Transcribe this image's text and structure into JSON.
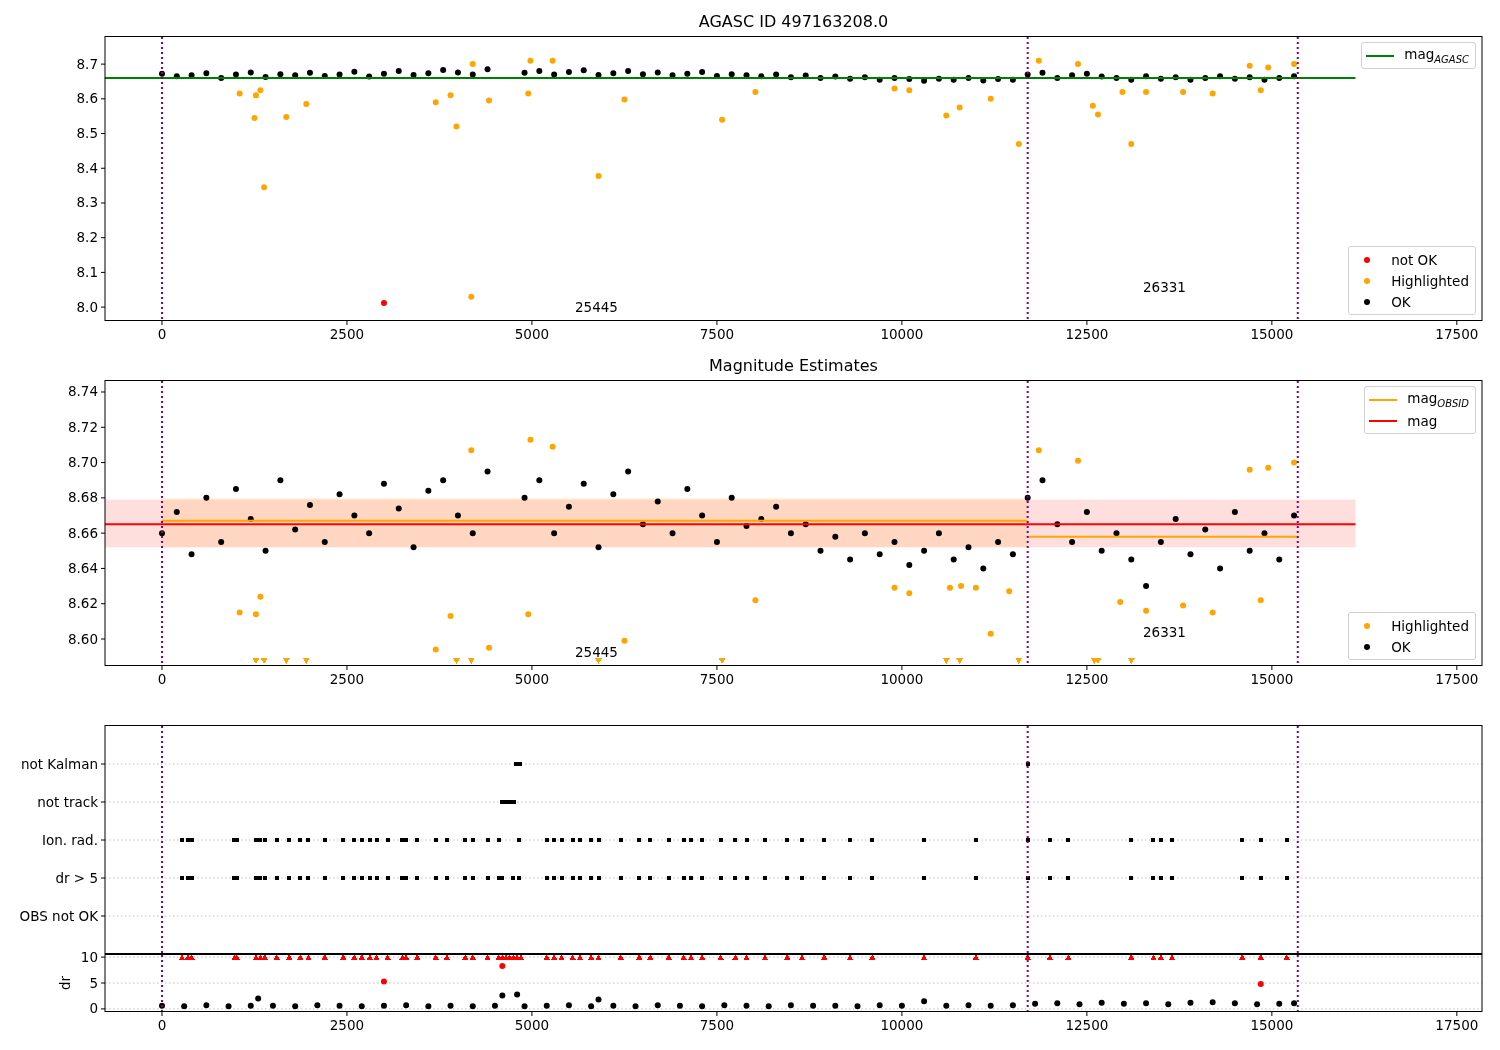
{
  "panels": [
    {
      "chart_data": {
        "type": "scatter",
        "title": "AGASC ID 497163208.0",
        "legend": "right",
        "xlim": [
          -770,
          17840
        ],
        "ylim": [
          7.96,
          8.781
        ],
        "xticks": [
          0,
          2500,
          5000,
          7500,
          10000,
          12500,
          15000,
          17500
        ],
        "yticks": [
          {
            "value": 8.0,
            "label": "8.0"
          },
          {
            "value": 8.1,
            "label": "8.1"
          },
          {
            "value": 8.2,
            "label": "8.2"
          },
          {
            "value": 8.3,
            "label": "8.3"
          },
          {
            "value": 8.4,
            "label": "8.4"
          },
          {
            "value": 8.5,
            "label": "8.5"
          },
          {
            "value": 8.6,
            "label": "8.6"
          },
          {
            "value": 8.7,
            "label": "8.7"
          }
        ],
        "series": [
          {
            "name": "mag$_{AGASC}$",
            "type": "line",
            "color": "#008000",
            "x": [
              -770,
              16130
            ],
            "values": [
              8.66,
              8.66
            ]
          },
          {
            "name": "not OK",
            "type": "scatter",
            "color": "#ff0000",
            "x": [
              3000
            ],
            "values": [
              8.012
            ]
          },
          {
            "name": "Highlighted",
            "type": "scatter",
            "color": "#ffa500",
            "x": [
              1050,
              1250,
              1270,
              1330,
              1380,
              1680,
              1950,
              3700,
              3900,
              3980,
              4180,
              4200,
              4420,
              4950,
              4980,
              5280,
              5900,
              6250,
              7570,
              8020,
              9900,
              10100,
              10600,
              10780,
              11200,
              11580,
              11850,
              12380,
              12580,
              12650,
              12980,
              13100,
              13300,
              13800,
              14200,
              14700,
              14850,
              14950,
              15300
            ],
            "values": [
              8.615,
              8.545,
              8.61,
              8.625,
              8.345,
              8.548,
              8.585,
              8.59,
              8.61,
              8.52,
              8.03,
              8.7,
              8.595,
              8.615,
              8.71,
              8.71,
              8.378,
              8.598,
              8.54,
              8.62,
              8.63,
              8.625,
              8.552,
              8.575,
              8.6,
              8.47,
              8.71,
              8.7,
              8.58,
              8.555,
              8.62,
              8.47,
              8.62,
              8.62,
              8.615,
              8.695,
              8.625,
              8.69,
              8.7
            ]
          },
          {
            "name": "OK",
            "type": "scatter",
            "color": "#000000",
            "x": [
              0,
              200,
              400,
              600,
              800,
              1000,
              1200,
              1400,
              1600,
              1800,
              2000,
              2200,
              2400,
              2600,
              2800,
              3000,
              3200,
              3400,
              3600,
              3800,
              4000,
              4200,
              4400,
              4900,
              5100,
              5300,
              5500,
              5700,
              5900,
              6100,
              6300,
              6500,
              6700,
              6900,
              7100,
              7300,
              7500,
              7700,
              7900,
              8100,
              8300,
              8500,
              8700,
              8900,
              9100,
              9300,
              9500,
              9700,
              9900,
              10100,
              10300,
              10500,
              10700,
              10900,
              11100,
              11300,
              11500,
              11700,
              11900,
              12100,
              12300,
              12500,
              12700,
              12900,
              13100,
              13300,
              13500,
              13700,
              13900,
              14100,
              14300,
              14500,
              14700,
              14900,
              15100,
              15300
            ],
            "values": [
              8.672,
              8.665,
              8.668,
              8.674,
              8.66,
              8.67,
              8.676,
              8.663,
              8.671,
              8.668,
              8.675,
              8.666,
              8.67,
              8.678,
              8.664,
              8.672,
              8.68,
              8.669,
              8.674,
              8.683,
              8.676,
              8.67,
              8.685,
              8.675,
              8.68,
              8.67,
              8.677,
              8.682,
              8.669,
              8.674,
              8.68,
              8.671,
              8.676,
              8.668,
              8.672,
              8.677,
              8.666,
              8.671,
              8.668,
              8.665,
              8.67,
              8.662,
              8.667,
              8.66,
              8.664,
              8.658,
              8.662,
              8.655,
              8.66,
              8.657,
              8.652,
              8.658,
              8.655,
              8.66,
              8.653,
              8.657,
              8.655,
              8.67,
              8.675,
              8.66,
              8.668,
              8.672,
              8.664,
              8.66,
              8.655,
              8.665,
              8.658,
              8.662,
              8.655,
              8.66,
              8.665,
              8.658,
              8.662,
              8.655,
              8.66,
              8.665
            ]
          }
        ],
        "ref_lines": [
          {
            "axis": "x",
            "value": 0
          },
          {
            "axis": "x",
            "value": 11700
          },
          {
            "axis": "x",
            "value": 15350
          }
        ],
        "annotations": [
          "25445",
          "26331"
        ]
      }
    },
    {
      "chart_data": {
        "type": "scatter",
        "title": "Magnitude Estimates",
        "legend": "right",
        "xlim": [
          -770,
          17840
        ],
        "ylim": [
          8.5847,
          8.7468
        ],
        "xticks": [
          0,
          2500,
          5000,
          7500,
          10000,
          12500,
          15000,
          17500
        ],
        "yticks": [
          {
            "value": 8.6,
            "label": "8.60"
          },
          {
            "value": 8.62,
            "label": "8.62"
          },
          {
            "value": 8.64,
            "label": "8.64"
          },
          {
            "value": 8.66,
            "label": "8.66"
          },
          {
            "value": 8.68,
            "label": "8.68"
          },
          {
            "value": 8.7,
            "label": "8.70"
          },
          {
            "value": 8.72,
            "label": "8.72"
          },
          {
            "value": 8.74,
            "label": "8.74"
          }
        ],
        "series": [
          {
            "name": "mag$_{OBSID}$",
            "type": "line",
            "color": "#ffa500",
            "x": [
              0,
              11690,
              11700,
              11710,
              15350
            ],
            "values": [
              8.667,
              8.667,
              null,
              8.658,
              8.658
            ]
          },
          {
            "name": "mag",
            "type": "line",
            "color": "#ff0000",
            "x": [
              -770,
              16130
            ],
            "values": [
              8.665,
              8.665
            ]
          },
          {
            "name": "Highlighted",
            "type": "scatter",
            "color": "#ffa500",
            "x": [
              1050,
              1270,
              1330,
              3700,
              3900,
              4180,
              4420,
              4950,
              4980,
              5280,
              6250,
              8020,
              9900,
              10100,
              10650,
              10800,
              11000,
              11200,
              11450,
              11850,
              12380,
              12950,
              13300,
              13800,
              14200,
              14700,
              14850,
              14950,
              15300
            ],
            "values": [
              8.615,
              8.614,
              8.624,
              8.594,
              8.613,
              8.707,
              8.595,
              8.614,
              8.713,
              8.709,
              8.599,
              8.622,
              8.629,
              8.626,
              8.629,
              8.63,
              8.629,
              8.603,
              8.627,
              8.707,
              8.701,
              8.621,
              8.616,
              8.619,
              8.615,
              8.696,
              8.622,
              8.697,
              8.7
            ]
          },
          {
            "name": "OK",
            "type": "scatter",
            "color": "#000000",
            "x": [
              0,
              200,
              400,
              600,
              800,
              1000,
              1200,
              1400,
              1600,
              1800,
              2000,
              2200,
              2400,
              2600,
              2800,
              3000,
              3200,
              3400,
              3600,
              3800,
              4000,
              4200,
              4400,
              4900,
              5100,
              5300,
              5500,
              5700,
              5900,
              6100,
              6300,
              6500,
              6700,
              6900,
              7100,
              7300,
              7500,
              7700,
              7900,
              8100,
              8300,
              8500,
              8700,
              8900,
              9100,
              9300,
              9500,
              9700,
              9900,
              10100,
              10300,
              10500,
              10700,
              10900,
              11100,
              11300,
              11500,
              11700,
              11900,
              12100,
              12300,
              12500,
              12700,
              12900,
              13100,
              13300,
              13500,
              13700,
              13900,
              14100,
              14300,
              14500,
              14700,
              14900,
              15100,
              15300
            ],
            "values": [
              8.66,
              8.672,
              8.648,
              8.68,
              8.655,
              8.685,
              8.668,
              8.65,
              8.69,
              8.662,
              8.676,
              8.655,
              8.682,
              8.67,
              8.66,
              8.688,
              8.674,
              8.652,
              8.684,
              8.69,
              8.67,
              8.66,
              8.695,
              8.68,
              8.69,
              8.66,
              8.675,
              8.688,
              8.652,
              8.682,
              8.695,
              8.665,
              8.678,
              8.66,
              8.685,
              8.67,
              8.655,
              8.68,
              8.664,
              8.668,
              8.675,
              8.66,
              8.665,
              8.65,
              8.658,
              8.645,
              8.66,
              8.648,
              8.655,
              8.642,
              8.65,
              8.66,
              8.645,
              8.652,
              8.64,
              8.655,
              8.648,
              8.68,
              8.69,
              8.665,
              8.655,
              8.672,
              8.65,
              8.66,
              8.645,
              8.63,
              8.655,
              8.668,
              8.648,
              8.662,
              8.64,
              8.672,
              8.65,
              8.66,
              8.645,
              8.67
            ]
          },
          {
            "type": "scatter",
            "marker": "triangle_down",
            "color": "#ffa500",
            "x": [
              1270,
              1380,
              1680,
              1950,
              3980,
              4180,
              5900,
              7570,
              10600,
              10780,
              11580,
              12600,
              12650,
              13100
            ],
            "values": [
              8.5875,
              8.5875,
              8.5875,
              8.5875,
              8.5875,
              8.5875,
              8.5875,
              8.5875,
              8.5875,
              8.5875,
              8.5875,
              8.5875,
              8.5875,
              8.5875
            ]
          }
        ],
        "bands": [
          {
            "axis": "y",
            "from": 8.652,
            "to": 8.679,
            "color": "#ff0000"
          },
          {
            "axis": "y",
            "from": 8.652,
            "to": 8.68,
            "color": "#ffa500"
          }
        ],
        "ref_lines": [
          {
            "axis": "x",
            "value": 0
          },
          {
            "axis": "x",
            "value": 11700
          },
          {
            "axis": "x",
            "value": 15350
          }
        ],
        "annotations": [
          "25445",
          "26331"
        ]
      }
    },
    {
      "flag_rows": [
        "not Kalman",
        "not track",
        "Ion. rad.",
        "dr > 5",
        "OBS not OK"
      ]
    },
    {
      "chart_data": {
        "type": "scatter",
        "xlim": [
          -770,
          17840
        ],
        "ylim": [
          -0.6,
          10.6
        ],
        "grid": true,
        "ylabel": "dr",
        "xticks": [
          0,
          2500,
          5000,
          7500,
          10000,
          12500,
          15000,
          17500
        ],
        "yticks": [
          0,
          5,
          10
        ],
        "series": [
          {
            "type": "scatter",
            "color": "#000000",
            "x": [
              0,
              300,
              600,
              900,
              1200,
              1300,
              1500,
              1800,
              2100,
              2400,
              2700,
              3000,
              3300,
              3600,
              3900,
              4200,
              4500,
              4600,
              4800,
              4900,
              5200,
              5500,
              5800,
              5900,
              6100,
              6400,
              6700,
              7000,
              7300,
              7600,
              7900,
              8200,
              8500,
              8800,
              9100,
              9400,
              9700,
              10000,
              10300,
              10600,
              10900,
              11200,
              11500,
              11800,
              12100,
              12400,
              12700,
              13000,
              13300,
              13600,
              13900,
              14200,
              14500,
              14800,
              15100,
              15300
            ],
            "values": [
              0.6,
              0.5,
              0.7,
              0.5,
              0.6,
              2.0,
              0.6,
              0.5,
              0.7,
              0.6,
              0.5,
              0.6,
              0.7,
              0.5,
              0.6,
              0.5,
              0.6,
              2.6,
              2.8,
              0.5,
              0.6,
              0.7,
              0.5,
              1.8,
              0.6,
              0.5,
              0.7,
              0.6,
              0.5,
              0.7,
              0.6,
              0.5,
              0.7,
              0.6,
              0.6,
              0.5,
              0.7,
              0.6,
              1.5,
              0.6,
              0.7,
              0.6,
              0.7,
              1.0,
              1.1,
              0.9,
              1.2,
              1.0,
              1.1,
              0.9,
              1.2,
              1.3,
              1.1,
              0.9,
              1.0,
              1.1
            ]
          },
          {
            "type": "scatter",
            "marker": "triangle",
            "color": "#ff0000",
            "x": [
              270,
              350,
              400,
              980,
              1010,
              1270,
              1330,
              1390,
              1550,
              1720,
              1870,
              1980,
              2200,
              2450,
              2600,
              2700,
              2810,
              2900,
              3050,
              3250,
              3300,
              3450,
              3700,
              3850,
              4100,
              4200,
              4400,
              4550,
              4600,
              4650,
              4700,
              4750,
              4800,
              4850,
              5200,
              5300,
              5400,
              5550,
              5650,
              5800,
              5900,
              6200,
              6450,
              6600,
              6850,
              7050,
              7150,
              7300,
              7550,
              7750,
              7900,
              8150,
              8450,
              8650,
              8950,
              9300,
              9600,
              10300,
              11000,
              11700,
              12000,
              12250,
              13100,
              13400,
              13500,
              13650,
              14600,
              14850,
              15200
            ],
            "values": [
              10,
              10,
              10,
              10,
              10,
              10,
              10,
              10,
              10,
              10,
              10,
              10,
              10,
              10,
              10,
              10,
              10,
              10,
              10,
              10,
              10,
              10,
              10,
              10,
              10,
              10,
              10,
              10,
              10,
              10,
              10,
              10,
              10,
              10,
              10,
              10,
              10,
              10,
              10,
              10,
              10,
              10,
              10,
              10,
              10,
              10,
              10,
              10,
              10,
              10,
              10,
              10,
              10,
              10,
              10,
              10,
              10,
              10,
              10,
              10,
              10,
              10,
              10,
              10,
              10,
              10,
              10,
              10,
              10
            ]
          },
          {
            "type": "scatter",
            "color": "#ff0000",
            "x": [
              3000,
              4600,
              14850
            ],
            "values": [
              5.3,
              8.3,
              4.8
            ]
          }
        ],
        "ref_lines": [
          {
            "axis": "x",
            "value": 0
          },
          {
            "axis": "x",
            "value": 11700
          },
          {
            "axis": "x",
            "value": 15350
          }
        ]
      }
    }
  ]
}
